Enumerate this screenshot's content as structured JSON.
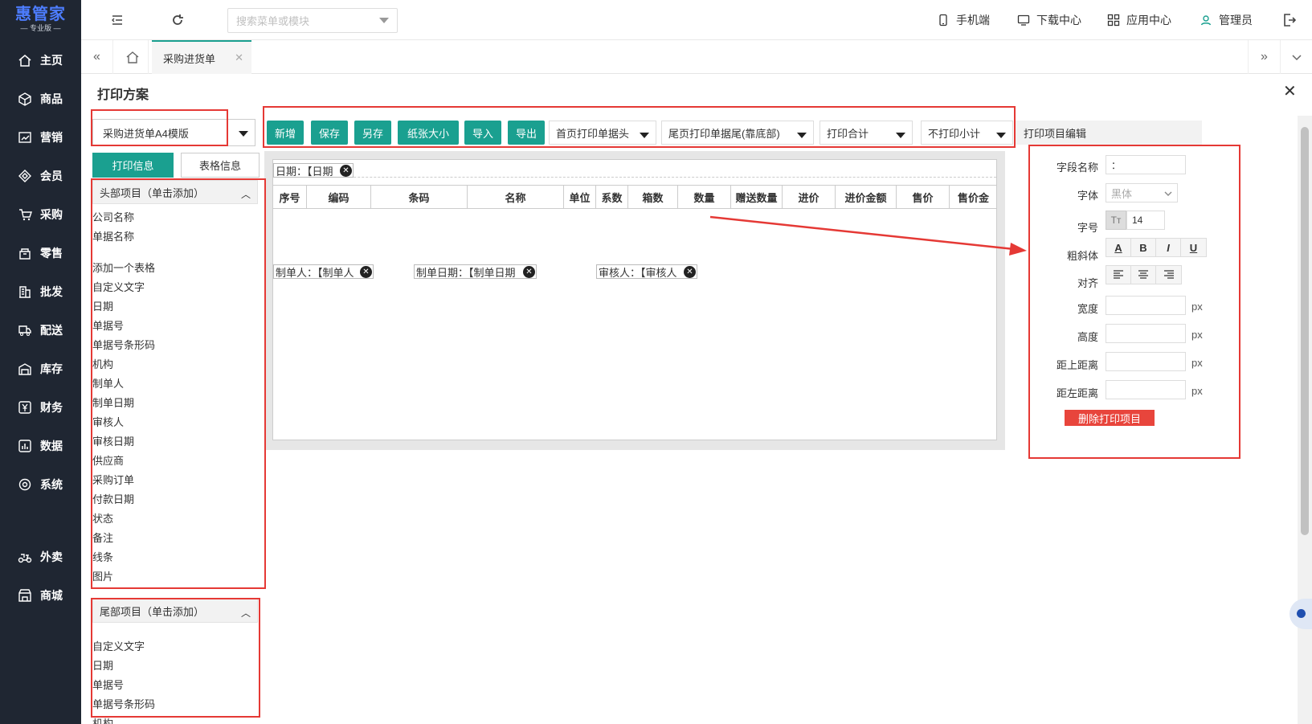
{
  "brand": {
    "name": "惠管家",
    "edition": "— 专业版 —"
  },
  "sidebar": {
    "items": [
      {
        "label": "主页",
        "icon": "home-icon"
      },
      {
        "label": "商品",
        "icon": "box-icon"
      },
      {
        "label": "营销",
        "icon": "chart-icon"
      },
      {
        "label": "会员",
        "icon": "diamond-icon"
      },
      {
        "label": "采购",
        "icon": "cart-icon"
      },
      {
        "label": "零售",
        "icon": "shop-icon"
      },
      {
        "label": "批发",
        "icon": "building-icon"
      },
      {
        "label": "配送",
        "icon": "truck-icon"
      },
      {
        "label": "库存",
        "icon": "warehouse-icon"
      },
      {
        "label": "财务",
        "icon": "yen-icon"
      },
      {
        "label": "数据",
        "icon": "data-icon"
      },
      {
        "label": "系统",
        "icon": "settings-icon"
      },
      {
        "label": "外卖",
        "icon": "delivery-icon"
      },
      {
        "label": "商城",
        "icon": "store-icon"
      }
    ]
  },
  "topbar": {
    "search_placeholder": "搜索菜单或模块",
    "links": {
      "mobile": "手机端",
      "download": "下载中心",
      "apps": "应用中心",
      "user": "管理员"
    }
  },
  "tabs": {
    "active": "采购进货单"
  },
  "panel": {
    "title": "打印方案",
    "template_select": "采购进货单A4模版",
    "toolbar": {
      "buttons": [
        "新增",
        "保存",
        "另存",
        "纸张大小",
        "导入",
        "导出"
      ],
      "dropdowns": [
        "首页打印单据头",
        "尾页打印单据尾(靠底部)",
        "打印合计",
        "不打印小计"
      ],
      "edit_title": "打印项目编辑"
    },
    "left_tabs": {
      "print_info": "打印信息",
      "table_info": "表格信息"
    },
    "header_items": {
      "title": "头部项目（单击添加）",
      "items": [
        "公司名称",
        "单据名称",
        "添加一个表格",
        "自定义文字",
        "日期",
        "单据号",
        "单据号条形码",
        "机构",
        "制单人",
        "制单日期",
        "审核人",
        "审核日期",
        "供应商",
        "采购订单",
        "付款日期",
        "状态",
        "备注",
        "线条",
        "图片"
      ]
    },
    "footer_items": {
      "title": "尾部项目（单击添加）",
      "items": [
        "自定义文字",
        "日期",
        "单据号",
        "单据号条形码",
        "机构"
      ]
    },
    "canvas": {
      "date_field": "日期：【日期",
      "columns": [
        "序号",
        "编码",
        "条码",
        "名称",
        "单位",
        "系数",
        "箱数",
        "数量",
        "赠送数量",
        "进价",
        "进价金额",
        "售价",
        "售价金"
      ],
      "footer_fields": [
        "制单人：【制单人",
        "制单日期：【制单日期",
        "审核人：【审核人"
      ]
    },
    "editor": {
      "field_name_label": "字段名称",
      "field_name_value": "：",
      "font_label": "字体",
      "font_value": "黑体",
      "size_label": "字号",
      "size_value": "14",
      "style_label": "粗斜体",
      "style_buttons": [
        "A",
        "B",
        "I",
        "U"
      ],
      "align_label": "对齐",
      "width_label": "宽度",
      "height_label": "高度",
      "top_label": "距上距离",
      "left_label": "距左距离",
      "unit": "px",
      "delete_button": "删除打印项目"
    }
  },
  "colors": {
    "sidebar_bg": "#1f2632",
    "accent": "#1aa090",
    "annotation": "#e53935",
    "danger": "#e8453c"
  }
}
